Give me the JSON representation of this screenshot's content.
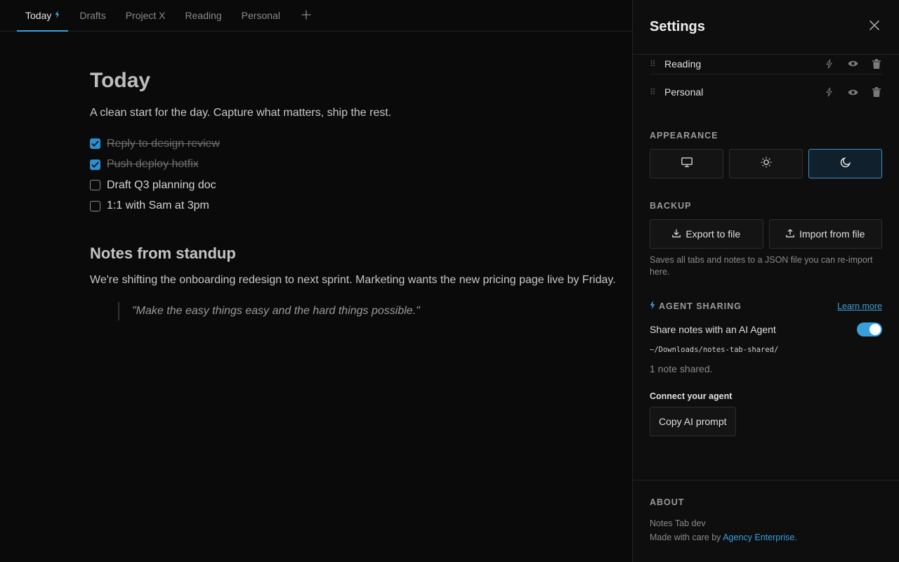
{
  "tabs": [
    {
      "label": "Today",
      "active": true,
      "agent": true
    },
    {
      "label": "Drafts"
    },
    {
      "label": "Project X"
    },
    {
      "label": "Reading"
    },
    {
      "label": "Personal"
    }
  ],
  "add_tab_symbol": "+",
  "note": {
    "title": "Today",
    "intro": "A clean start for the day. Capture what matters, ship the rest.",
    "todos": [
      {
        "text": "Reply to design review",
        "checked": true
      },
      {
        "text": "Push deploy hotfix",
        "checked": true
      },
      {
        "text": "Draft Q3 planning doc",
        "checked": false
      },
      {
        "text": "1:1 with Sam at 3pm",
        "checked": false
      }
    ],
    "heading2": "Notes from standup",
    "paragraph": "We're shifting the onboarding redesign to next sprint. Marketing wants the new pricing page live by Friday.",
    "quote": "\"Make the easy things easy and the hard things possible.\""
  },
  "settings": {
    "title": "Settings",
    "tab_rows": [
      {
        "name": "Reading"
      },
      {
        "name": "Personal"
      }
    ],
    "appearance": {
      "label": "APPEARANCE",
      "options": [
        {
          "icon": "monitor-icon",
          "value": "system"
        },
        {
          "icon": "sun-icon",
          "value": "light"
        },
        {
          "icon": "moon-icon",
          "value": "dark"
        }
      ],
      "selected": "dark"
    },
    "backup": {
      "label": "BACKUP",
      "export_label": "Export to file",
      "import_label": "Import from file",
      "hint": "Saves all tabs and notes to a JSON file you can re-import here."
    },
    "agent": {
      "label": "AGENT SHARING",
      "learn_more": "Learn more",
      "share_label": "Share notes with an AI Agent",
      "share_enabled": true,
      "path": "~/Downloads/notes-tab-shared/",
      "shared_count": "1 note shared.",
      "connect_label": "Connect your agent",
      "copy_button": "Copy AI prompt"
    },
    "about": {
      "label": "ABOUT",
      "app_name": "Notes Tab dev",
      "credit_prefix": "Made with care by ",
      "credit_link": "Agency Enterprise",
      "credit_suffix": "."
    }
  },
  "colors": {
    "accent": "#3aa0dc",
    "background": "#0a0a0a",
    "panel": "#0e0e0e"
  }
}
